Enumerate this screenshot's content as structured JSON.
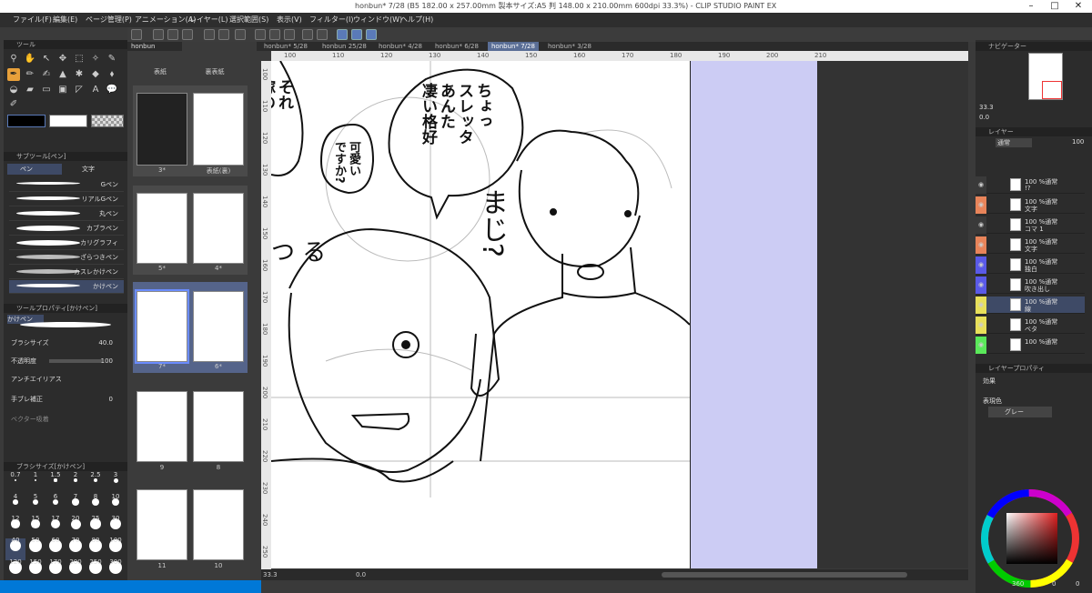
{
  "titlebar": {
    "title": "honbun* 7/28 (B5 182.00 x 257.00mm 製本サイズ:A5 判 148.00 x 210.00mm 600dpi 33.3%) - CLIP STUDIO PAINT EX"
  },
  "menu": [
    "ファイル(F)",
    "編集(E)",
    "ページ管理(P)",
    "アニメーション(A)",
    "レイヤー(L)",
    "選択範囲(S)",
    "表示(V)",
    "フィルター(I)",
    "ウィンドウ(W)",
    "ヘルプ(H)"
  ],
  "tools_panel": {
    "header": "ツール",
    "subtool_header": "サブツール[ペン]",
    "subtool_tabs": [
      "ペン",
      "文字"
    ],
    "brushes": [
      "Gペン",
      "リアルGペン",
      "丸ペン",
      "カブラペン",
      "カリグラフィ",
      "ざらつきペン",
      "カスレかけペン",
      "かけペン"
    ],
    "selected_brush": "かけペン",
    "property_header": "ツールプロパティ[かけペン]",
    "property_title": "かけペン",
    "properties": [
      {
        "label": "ブラシサイズ",
        "value": "40.0"
      },
      {
        "label": "不透明度",
        "value": "100"
      },
      {
        "label": "アンチエイリアス",
        "value": ""
      },
      {
        "label": "手ブレ補正",
        "value": "0"
      },
      {
        "label": "ベクター吸着",
        "value": ""
      }
    ],
    "brushsize_header": "ブラシサイズ[かけペン]",
    "sizes": [
      "0.7",
      "1",
      "1.5",
      "2",
      "2.5",
      "3",
      "4",
      "5",
      "6",
      "7",
      "8",
      "10",
      "12",
      "15",
      "17",
      "20",
      "25",
      "30",
      "40",
      "50",
      "60",
      "70",
      "80",
      "100",
      "120",
      "150",
      "170",
      "200",
      "250",
      "300"
    ]
  },
  "page_panel": {
    "tab": "honbun",
    "top_labels": [
      "表紙",
      "裏表紙"
    ],
    "spreads": [
      {
        "left": "3*",
        "right": "表紙(裏)"
      },
      {
        "left": "5*",
        "right": "4*"
      },
      {
        "left": "7*",
        "right": "6*"
      },
      {
        "left": "9",
        "right": "8"
      },
      {
        "left": "11",
        "right": "10"
      }
    ]
  },
  "doc_tabs": [
    "honbun* 5/28",
    "honbun 25/28",
    "honbun* 4/28",
    "honbun* 6/28",
    "honbun* 7/28",
    "honbun* 3/28"
  ],
  "ruler_top": [
    "100",
    "110",
    "120",
    "130",
    "140",
    "150",
    "160",
    "170",
    "180",
    "190",
    "200",
    "210"
  ],
  "ruler_left": [
    "100",
    "110",
    "120",
    "130",
    "140",
    "150",
    "160",
    "170",
    "180",
    "190",
    "200",
    "210",
    "220",
    "230",
    "240",
    "250"
  ],
  "speech": {
    "bubble1": [
      "ちょっ",
      "スレッタ",
      "あんた",
      "凄い格好"
    ],
    "bubble2": [
      "可愛い",
      "ですか?"
    ],
    "bubble3": [
      "それ",
      "嫁の"
    ],
    "sfx": "まじ?",
    "sfx2": "つ る"
  },
  "status": {
    "zoom": "33.3",
    "angle": "0.0"
  },
  "right_panel": {
    "navigator_header": "ナビゲーター",
    "nav_zoom": "33.3",
    "nav_angle": "0.0",
    "layer_header": "レイヤー",
    "blend": "通常",
    "opacity": "100",
    "layers": [
      {
        "name": "!?",
        "mode": "100 %通常",
        "color": "#3a3a3a"
      },
      {
        "name": "文字",
        "mode": "100 %通常",
        "color": "#e8845a"
      },
      {
        "name": "コマ 1",
        "mode": "100 %通常",
        "color": "#3a3a3a"
      },
      {
        "name": "文字",
        "mode": "100 %通常",
        "color": "#e8845a"
      },
      {
        "name": "独白",
        "mode": "100 %通常",
        "color": "#5a5ae8"
      },
      {
        "name": "吹き出し",
        "mode": "100 %通常",
        "color": "#5a5ae8"
      },
      {
        "name": "線",
        "mode": "100 %通常",
        "color": "#e8e05a"
      },
      {
        "name": "ベタ",
        "mode": "100 %通常",
        "color": "#e8e05a"
      },
      {
        "name": "",
        "mode": "100 %通常",
        "color": "#5ae85a"
      }
    ],
    "prop_header": "レイヤープロパティ",
    "effect_label": "効果",
    "express_label": "表現色",
    "express_value": "グレー",
    "color_bottom": [
      "360",
      "0",
      "0"
    ]
  },
  "colors": {
    "accent": "#e8a03a",
    "select": "#5a6e96",
    "bleed": "#ccccf4"
  }
}
